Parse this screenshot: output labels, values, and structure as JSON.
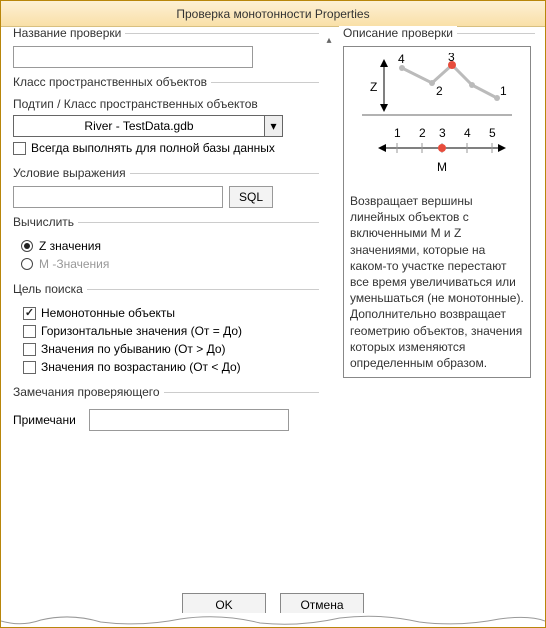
{
  "window": {
    "title": "Проверка монотонности Properties"
  },
  "leftPanel": {
    "checkName": {
      "label": "Название проверки",
      "value": ""
    },
    "featureClass": {
      "label": "Класс пространственных объектов",
      "subtypeLabel": "Подтип / Класс пространственных объектов",
      "comboValue": "River -  TestData.gdb",
      "always": {
        "checked": false,
        "label": "Всегда выполнять для полной базы данных"
      }
    },
    "condition": {
      "label": "Условие выражения",
      "value": "",
      "sqlBtn": "SQL"
    },
    "compute": {
      "label": "Вычислить",
      "options": {
        "z": {
          "label": "Z значения",
          "selected": true
        },
        "m": {
          "label": "M -Значения",
          "selected": false,
          "disabled": true
        }
      }
    },
    "target": {
      "label": "Цель поиска",
      "items": {
        "nonmono": {
          "checked": true,
          "label": "Немонотонные объекты"
        },
        "horiz": {
          "checked": false,
          "label": "Горизонтальные значения (От = До)"
        },
        "desc": {
          "checked": false,
          "label": "Значения по убыванию (От > До)"
        },
        "asc": {
          "checked": false,
          "label": "Значения по возрастанию (От < До)"
        }
      }
    },
    "reviewer": {
      "label": "Замечания проверяющего",
      "noteLabel": "Примечани",
      "noteValue": ""
    }
  },
  "rightPanel": {
    "title": "Описание проверки",
    "diagram": {
      "zLabel": "Z",
      "mLabel": "M",
      "topPoints": [
        "4",
        "3",
        "2",
        "1"
      ],
      "bottomTicks": [
        "1",
        "2",
        "3",
        "4",
        "5"
      ]
    },
    "description": "Возвращает вершины линейных объектов с включенными M и Z значениями, которые на каком-то участке перестают все время увеличиваться или уменьшаться (не монотонные). Дополнительно возвращает геометрию объектов, значения которых изменяются определенным образом."
  },
  "buttons": {
    "ok": "OK",
    "cancel": "Отмена"
  }
}
